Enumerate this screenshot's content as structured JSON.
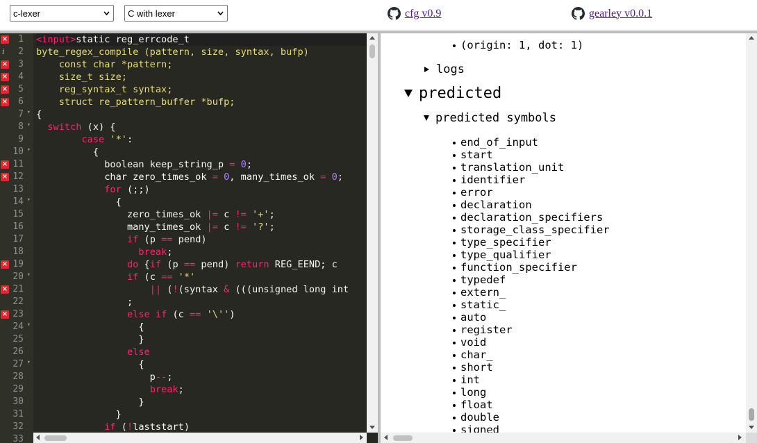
{
  "toolbar": {
    "lexer_select": "c-lexer",
    "language_select": "C with lexer",
    "cfg_link": "cfg v0.9",
    "gearley_link": "gearley v0.0.1"
  },
  "editor": {
    "lines": [
      {
        "n": "1",
        "mark": "err",
        "fold": false,
        "segs": [
          [
            "pink",
            "<input>"
          ],
          [
            "",
            "static reg_errcode_t"
          ]
        ]
      },
      {
        "n": "2",
        "mark": "info",
        "fold": false,
        "segs": [
          [
            "yellow",
            "byte_regex_compile (pattern, size, syntax, bufp)"
          ]
        ]
      },
      {
        "n": "3",
        "mark": "err",
        "fold": false,
        "segs": [
          [
            "yellow",
            "    const char *pattern;"
          ]
        ]
      },
      {
        "n": "4",
        "mark": "err",
        "fold": false,
        "segs": [
          [
            "yellow",
            "    size_t size;"
          ]
        ]
      },
      {
        "n": "5",
        "mark": "err",
        "fold": false,
        "segs": [
          [
            "yellow",
            "    reg_syntax_t syntax;"
          ]
        ]
      },
      {
        "n": "6",
        "mark": "err",
        "fold": false,
        "segs": [
          [
            "yellow",
            "    struct re_pattern_buffer *bufp;"
          ]
        ]
      },
      {
        "n": "7",
        "mark": "",
        "fold": true,
        "segs": [
          [
            "",
            "{"
          ]
        ]
      },
      {
        "n": "8",
        "mark": "",
        "fold": true,
        "segs": [
          [
            "",
            "  "
          ],
          [
            "pink",
            "switch"
          ],
          [
            "",
            " (x) {"
          ]
        ]
      },
      {
        "n": "9",
        "mark": "",
        "fold": false,
        "segs": [
          [
            "",
            "        "
          ],
          [
            "pink",
            "case"
          ],
          [
            "",
            " "
          ],
          [
            "yellow",
            "'*'"
          ],
          [
            "",
            ":"
          ]
        ]
      },
      {
        "n": "10",
        "mark": "",
        "fold": true,
        "segs": [
          [
            "",
            "          {"
          ]
        ]
      },
      {
        "n": "11",
        "mark": "err",
        "fold": false,
        "segs": [
          [
            "",
            "            boolean keep_string_p "
          ],
          [
            "pink",
            "="
          ],
          [
            "",
            " "
          ],
          [
            "purple",
            "0"
          ],
          [
            "",
            ";"
          ]
        ]
      },
      {
        "n": "12",
        "mark": "err",
        "fold": false,
        "segs": [
          [
            "",
            "            char zero_times_ok "
          ],
          [
            "pink",
            "="
          ],
          [
            "",
            " "
          ],
          [
            "purple",
            "0"
          ],
          [
            "",
            ", many_times_ok "
          ],
          [
            "pink",
            "="
          ],
          [
            "",
            " "
          ],
          [
            "purple",
            "0"
          ],
          [
            "",
            ";"
          ]
        ]
      },
      {
        "n": "13",
        "mark": "",
        "fold": false,
        "segs": [
          [
            "",
            "            "
          ],
          [
            "pink",
            "for"
          ],
          [
            "",
            " (;;)"
          ]
        ]
      },
      {
        "n": "14",
        "mark": "",
        "fold": true,
        "segs": [
          [
            "",
            "              {"
          ]
        ]
      },
      {
        "n": "15",
        "mark": "",
        "fold": false,
        "segs": [
          [
            "",
            "                zero_times_ok "
          ],
          [
            "pink",
            "|="
          ],
          [
            "",
            " c "
          ],
          [
            "pink",
            "!="
          ],
          [
            "",
            " "
          ],
          [
            "yellow",
            "'+'"
          ],
          [
            "",
            ";"
          ]
        ]
      },
      {
        "n": "16",
        "mark": "",
        "fold": false,
        "segs": [
          [
            "",
            "                many_times_ok "
          ],
          [
            "pink",
            "|="
          ],
          [
            "",
            " c "
          ],
          [
            "pink",
            "!="
          ],
          [
            "",
            " "
          ],
          [
            "yellow",
            "'?'"
          ],
          [
            "",
            ";"
          ]
        ]
      },
      {
        "n": "17",
        "mark": "",
        "fold": false,
        "segs": [
          [
            "",
            "                "
          ],
          [
            "pink",
            "if"
          ],
          [
            "",
            " (p "
          ],
          [
            "pink",
            "=="
          ],
          [
            "",
            " pend)"
          ]
        ]
      },
      {
        "n": "18",
        "mark": "",
        "fold": false,
        "segs": [
          [
            "",
            "                  "
          ],
          [
            "pink",
            "break"
          ],
          [
            "",
            ";"
          ]
        ]
      },
      {
        "n": "19",
        "mark": "err",
        "fold": false,
        "segs": [
          [
            "",
            "                "
          ],
          [
            "pink",
            "do"
          ],
          [
            "",
            " {"
          ],
          [
            "pink",
            "if"
          ],
          [
            "",
            " (p "
          ],
          [
            "pink",
            "=="
          ],
          [
            "",
            " pend) "
          ],
          [
            "pink",
            "return"
          ],
          [
            "",
            " REG_EEND; c "
          ]
        ]
      },
      {
        "n": "20",
        "mark": "",
        "fold": true,
        "segs": [
          [
            "",
            "                "
          ],
          [
            "pink",
            "if"
          ],
          [
            "",
            " (c "
          ],
          [
            "pink",
            "=="
          ],
          [
            "",
            " "
          ],
          [
            "yellow",
            "'*'"
          ]
        ]
      },
      {
        "n": "21",
        "mark": "err",
        "fold": false,
        "segs": [
          [
            "",
            "                    "
          ],
          [
            "pink",
            "||"
          ],
          [
            "",
            " ("
          ],
          [
            "pink",
            "!"
          ],
          [
            "",
            "(syntax "
          ],
          [
            "pink",
            "&"
          ],
          [
            "",
            " (((unsigned long int"
          ]
        ]
      },
      {
        "n": "22",
        "mark": "",
        "fold": false,
        "segs": [
          [
            "",
            "                ;"
          ]
        ]
      },
      {
        "n": "23",
        "mark": "err",
        "fold": false,
        "segs": [
          [
            "",
            "                "
          ],
          [
            "pink",
            "else"
          ],
          [
            "",
            " "
          ],
          [
            "pink",
            "if"
          ],
          [
            "",
            " (c "
          ],
          [
            "pink",
            "=="
          ],
          [
            "",
            " "
          ],
          [
            "yellow",
            "'\\''"
          ],
          [
            "",
            ")"
          ]
        ]
      },
      {
        "n": "24",
        "mark": "",
        "fold": true,
        "segs": [
          [
            "",
            "                  {"
          ]
        ]
      },
      {
        "n": "25",
        "mark": "",
        "fold": false,
        "segs": [
          [
            "",
            "                  }"
          ]
        ]
      },
      {
        "n": "26",
        "mark": "",
        "fold": false,
        "segs": [
          [
            "",
            "                "
          ],
          [
            "pink",
            "else"
          ]
        ]
      },
      {
        "n": "27",
        "mark": "",
        "fold": true,
        "segs": [
          [
            "",
            "                  {"
          ]
        ]
      },
      {
        "n": "28",
        "mark": "",
        "fold": false,
        "segs": [
          [
            "",
            "                    p"
          ],
          [
            "pink",
            "--"
          ],
          [
            "",
            ";"
          ]
        ]
      },
      {
        "n": "29",
        "mark": "",
        "fold": false,
        "segs": [
          [
            "",
            "                    "
          ],
          [
            "pink",
            "break"
          ],
          [
            "",
            ";"
          ]
        ]
      },
      {
        "n": "30",
        "mark": "",
        "fold": false,
        "segs": [
          [
            "",
            "                  }"
          ]
        ]
      },
      {
        "n": "31",
        "mark": "",
        "fold": false,
        "segs": [
          [
            "",
            "              }"
          ]
        ]
      },
      {
        "n": "32",
        "mark": "",
        "fold": false,
        "segs": [
          [
            "",
            "            "
          ],
          [
            "pink",
            "if"
          ],
          [
            "",
            " ("
          ],
          [
            "pink",
            "!"
          ],
          [
            "",
            "laststart)"
          ]
        ]
      },
      {
        "n": "33",
        "mark": "",
        "fold": false,
        "segs": [
          [
            "",
            ""
          ]
        ]
      }
    ]
  },
  "panel": {
    "origin_item": "(origin: 1, dot: 1)",
    "logs_label": "logs",
    "predicted_heading": "predicted",
    "predicted_symbols_label": "predicted symbols",
    "symbols": [
      "end_of_input",
      "start",
      "translation_unit",
      "identifier",
      "error",
      "declaration",
      "declaration_specifiers",
      "storage_class_specifier",
      "type_specifier",
      "type_qualifier",
      "function_specifier",
      "typedef",
      "extern_",
      "static_",
      "auto",
      "register",
      "void",
      "char_",
      "short",
      "int",
      "long",
      "float",
      "double",
      "signed"
    ]
  },
  "colors": {
    "editor_bg": "#272822",
    "gutter_bg": "#2f3129",
    "keyword": "#f92672",
    "string": "#e6db74",
    "number": "#ae81ff",
    "error_marker": "#e8232a",
    "link": "#551a8b"
  }
}
